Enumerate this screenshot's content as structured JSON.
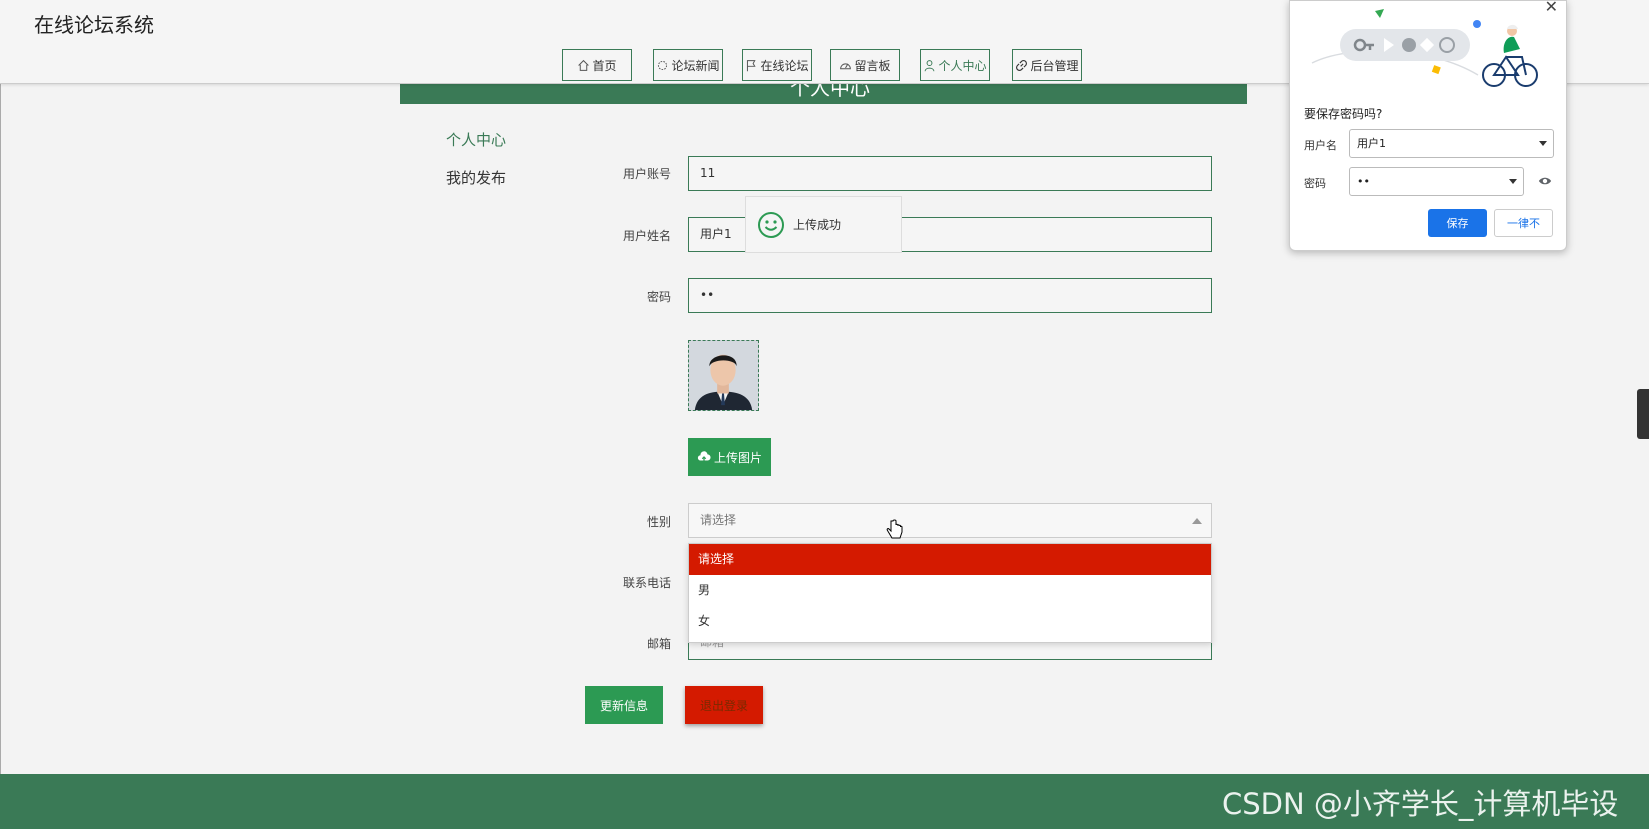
{
  "header": {
    "site_title": "在线论坛系统",
    "nav": [
      {
        "label": "首页",
        "icon": "home-icon"
      },
      {
        "label": "论坛新闻",
        "icon": "news-icon"
      },
      {
        "label": "在线论坛",
        "icon": "flag-icon"
      },
      {
        "label": "留言板",
        "icon": "gauge-icon"
      },
      {
        "label": "个人中心",
        "icon": "user-icon",
        "active": true
      },
      {
        "label": "后台管理",
        "icon": "link-icon"
      }
    ]
  },
  "banner": {
    "title": "个人中心"
  },
  "sidebar": {
    "title": "个人中心",
    "link": "我的发布"
  },
  "form": {
    "account_label": "用户账号",
    "account_value": "11",
    "name_label": "用户姓名",
    "name_value": "用户1",
    "password_label": "密码",
    "password_value": "••",
    "upload_label": "上传图片",
    "gender_label": "性别",
    "gender_placeholder": "请选择",
    "gender_options": [
      "请选择",
      "男",
      "女"
    ],
    "phone_label": "联系电话",
    "email_label": "邮箱",
    "email_placeholder": "邮箱",
    "update_button": "更新信息",
    "logout_button": "退出登录"
  },
  "toast": {
    "message": "上传成功"
  },
  "password_popup": {
    "title": "要保存密码吗?",
    "username_label": "用户名",
    "username_value": "用户1",
    "password_label": "密码",
    "password_value": "••",
    "save_button": "保存",
    "never_button": "一律不"
  },
  "watermark": "CSDN @小齐学长_计算机毕设",
  "colors": {
    "primary_green": "#3a7a56",
    "button_green": "#2c9a53",
    "danger_red": "#d41a00",
    "chrome_blue": "#1a73e8"
  }
}
